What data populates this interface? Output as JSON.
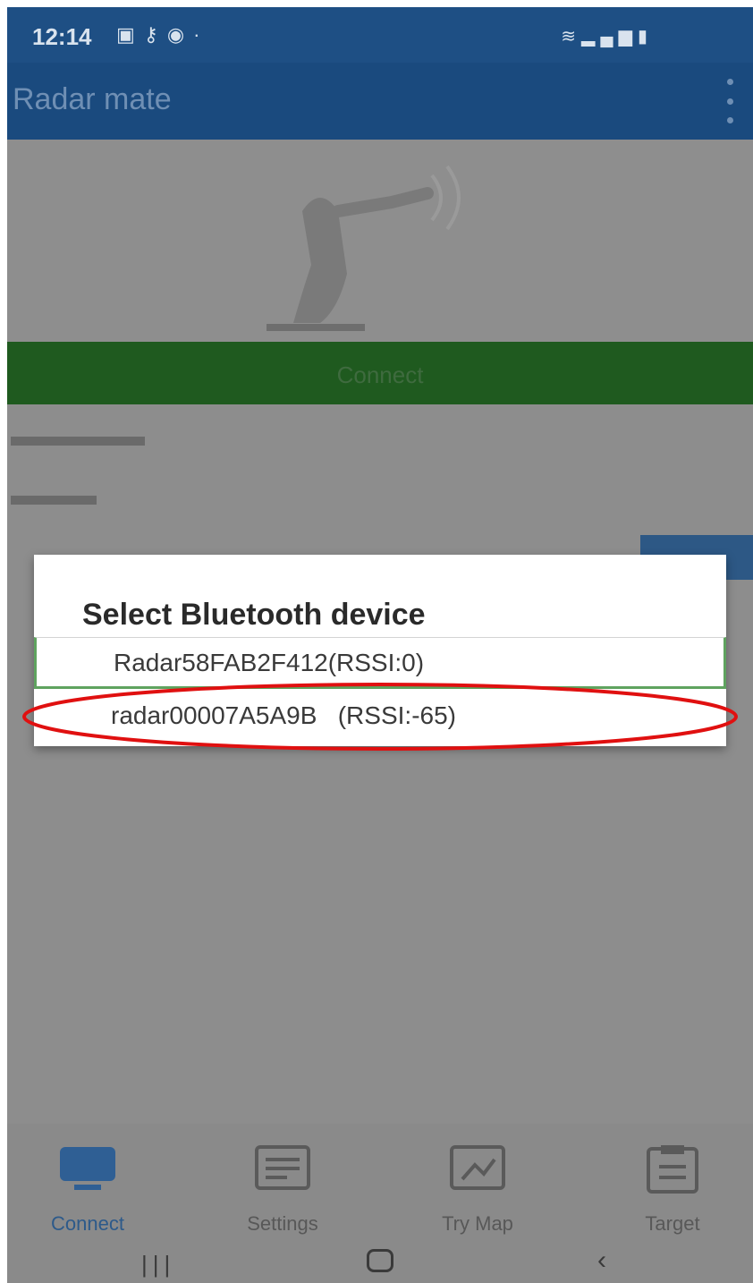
{
  "status_bar": {
    "time": "12:14",
    "left_icons": [
      "image-icon",
      "key-icon",
      "android-icon",
      "dot-icon"
    ],
    "right_icons": [
      "wifi-icon",
      "signal-icon",
      "battery-icon"
    ]
  },
  "app_bar": {
    "title": "Radar mate",
    "menu_icon": "overflow-menu-icon"
  },
  "connect_button": {
    "label": "Connect"
  },
  "dialog": {
    "title": "Select Bluetooth device",
    "devices": [
      {
        "label": "Radar58FAB2F412(RSSI:0)"
      },
      {
        "label": "radar00007A5A9B   (RSSI:-65)"
      }
    ],
    "highlight_color": "#e01010"
  },
  "bottom_nav": {
    "items": [
      {
        "label": "Connect",
        "icon": "monitor-icon",
        "active": true
      },
      {
        "label": "Settings",
        "icon": "settings-list-icon"
      },
      {
        "label": "Try Map",
        "icon": "map-icon"
      },
      {
        "label": "Target",
        "icon": "target-icon"
      }
    ]
  },
  "colors": {
    "app_bar": "#1a4a7e",
    "connect_bar": "#1f5a1f",
    "dialog_selected_border": "#5fa35f",
    "highlight_ellipse": "#e01010"
  }
}
